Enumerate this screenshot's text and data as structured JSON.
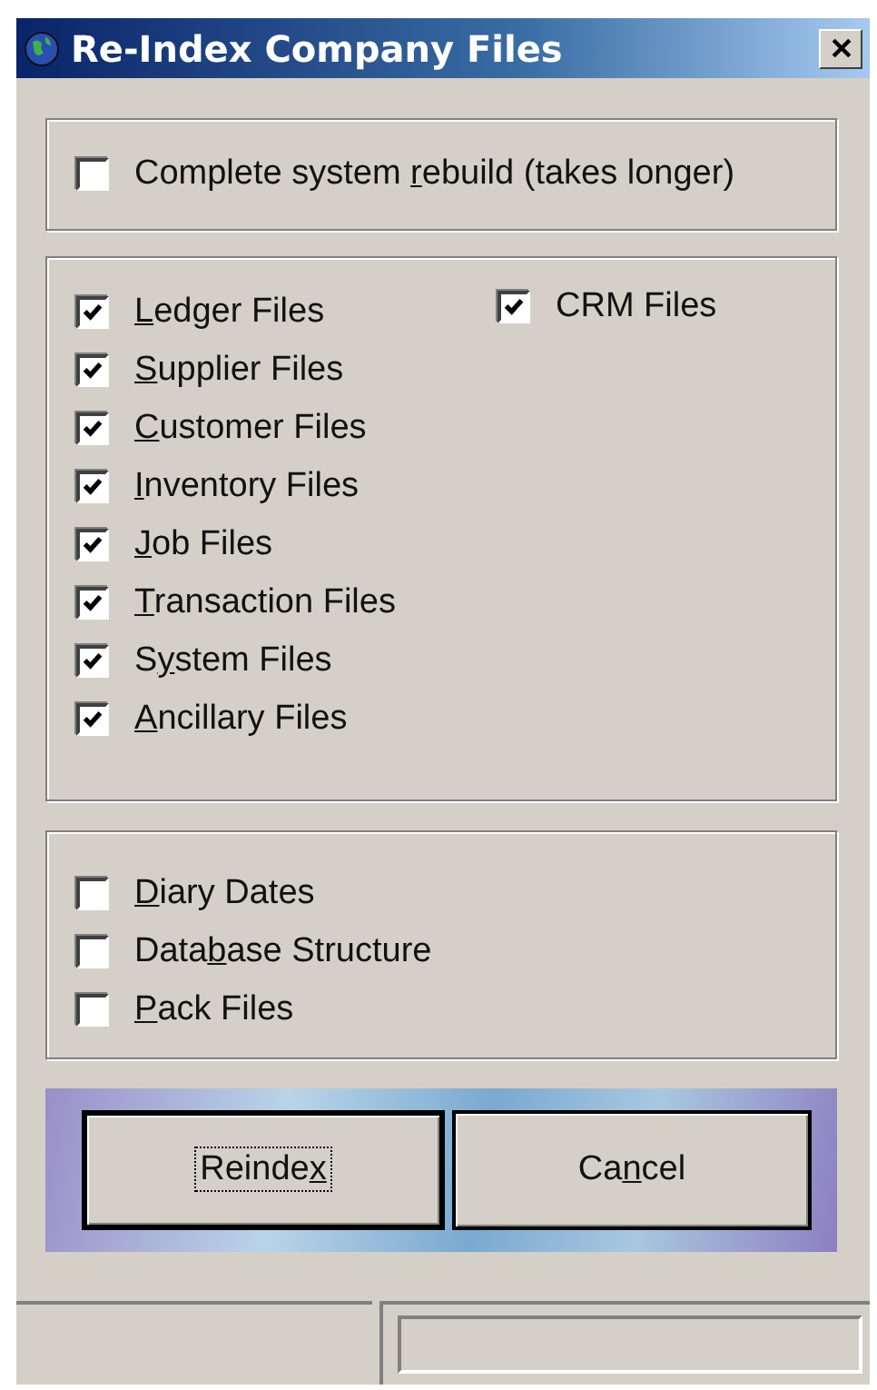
{
  "window": {
    "title": "Re-Index Company Files"
  },
  "rebuild": {
    "label": {
      "pre": "Complete system ",
      "key": "r",
      "post": "ebuild (takes longer)"
    },
    "checked": false
  },
  "file_groups": [
    {
      "label": {
        "key": "L",
        "post": "edger Files"
      },
      "checked": true
    },
    {
      "label": {
        "key": "S",
        "post": "upplier Files"
      },
      "checked": true
    },
    {
      "label": {
        "key": "C",
        "post": "ustomer Files"
      },
      "checked": true
    },
    {
      "label": {
        "key": "I",
        "post": "nventory Files"
      },
      "checked": true
    },
    {
      "label": {
        "key": "J",
        "post": "ob Files"
      },
      "checked": true
    },
    {
      "label": {
        "key": "T",
        "post": "ransaction Files"
      },
      "checked": true
    },
    {
      "label": {
        "pre": "S",
        "key": "y",
        "post": "stem Files"
      },
      "checked": true
    },
    {
      "label": {
        "key": "A",
        "post": "ncillary Files"
      },
      "checked": true
    }
  ],
  "crm": {
    "label": {
      "pre": "CRM Files"
    },
    "checked": true
  },
  "extras": [
    {
      "label": {
        "key": "D",
        "post": "iary Dates"
      },
      "checked": false
    },
    {
      "label": {
        "pre": "Data",
        "key": "b",
        "post": "ase Structure"
      },
      "checked": false
    },
    {
      "label": {
        "key": "P",
        "post": "ack Files"
      },
      "checked": false
    }
  ],
  "buttons": [
    {
      "label": {
        "pre": "Reinde",
        "key": "x"
      },
      "default": true
    },
    {
      "label": {
        "pre": "Ca",
        "key": "n",
        "post": "cel"
      },
      "default": false
    }
  ]
}
